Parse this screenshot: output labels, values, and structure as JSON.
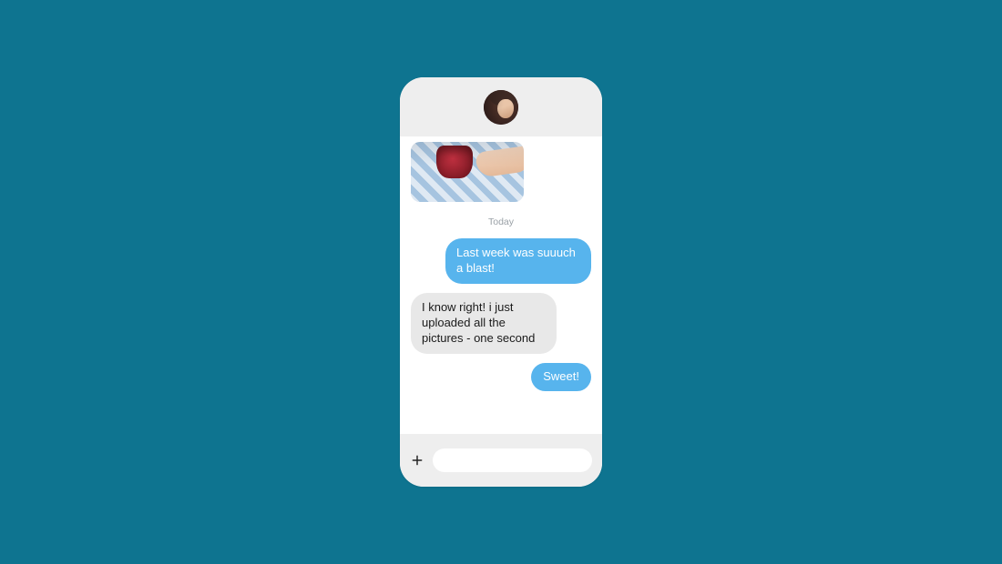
{
  "header": {
    "avatar_alt": "contact-avatar"
  },
  "thread": {
    "date_label": "Today",
    "image_alt": "shared-photo",
    "messages": {
      "m1": {
        "text": "Last week was suuuch a blast!",
        "direction": "sent"
      },
      "m2": {
        "text": "I know right! i just uploaded all the pictures - one second",
        "direction": "received"
      },
      "m3": {
        "text": "Sweet!",
        "direction": "sent"
      }
    }
  },
  "composer": {
    "placeholder": "",
    "value": ""
  },
  "colors": {
    "background": "#0e7490",
    "sent_bubble": "#57b4ed",
    "received_bubble": "#e8e8e8"
  }
}
